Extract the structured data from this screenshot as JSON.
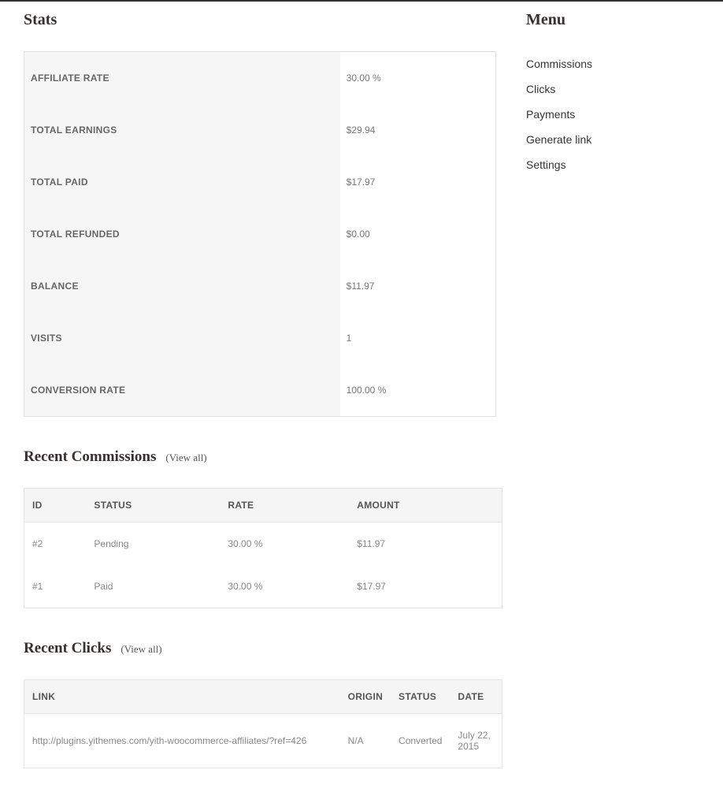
{
  "stats": {
    "title": "Stats",
    "rows": [
      {
        "label": "AFFILIATE RATE",
        "value": "30.00 %"
      },
      {
        "label": "TOTAL EARNINGS",
        "value": "$29.94"
      },
      {
        "label": "TOTAL PAID",
        "value": "$17.97"
      },
      {
        "label": "TOTAL REFUNDED",
        "value": "$0.00"
      },
      {
        "label": "BALANCE",
        "value": "$11.97"
      },
      {
        "label": "VISITS",
        "value": "1"
      },
      {
        "label": "CONVERSION RATE",
        "value": "100.00 %"
      }
    ]
  },
  "recent_commissions": {
    "title": "Recent Commissions",
    "view_all": "(View all)",
    "columns": [
      "ID",
      "STATUS",
      "RATE",
      "AMOUNT"
    ],
    "rows": [
      {
        "id": "#2",
        "status": "Pending",
        "rate": "30.00 %",
        "amount": "$11.97"
      },
      {
        "id": "#1",
        "status": "Paid",
        "rate": "30.00 %",
        "amount": "$17.97"
      }
    ]
  },
  "recent_clicks": {
    "title": "Recent Clicks",
    "view_all": "(View all)",
    "columns": [
      "LINK",
      "ORIGIN",
      "STATUS",
      "DATE"
    ],
    "rows": [
      {
        "link": "http://plugins.yithemes.com/yith-woocommerce-affiliates/?ref=426",
        "origin": "N/A",
        "status": "Converted",
        "date": "July 22, 2015"
      }
    ]
  },
  "menu": {
    "title": "Menu",
    "items": [
      {
        "label": "Commissions"
      },
      {
        "label": "Clicks"
      },
      {
        "label": "Payments"
      },
      {
        "label": "Generate link"
      },
      {
        "label": "Settings"
      }
    ]
  }
}
